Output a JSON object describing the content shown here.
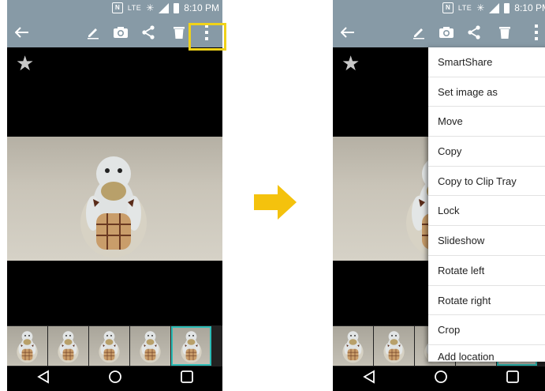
{
  "status_bar": {
    "lte": "LTE",
    "time": "8:10 PM",
    "nfc": "N"
  },
  "action_bar": {
    "icons": [
      "back-arrow-icon",
      "edit-icon",
      "camera-icon",
      "share-icon",
      "delete-icon",
      "overflow-menu-icon"
    ]
  },
  "viewer": {
    "favorite_icon": "star-icon"
  },
  "filmstrip": {
    "thumbnail_count": 5,
    "selected_index": 4
  },
  "nav_bar": {
    "icons": [
      "back-triangle-icon",
      "home-circle-icon",
      "recents-square-icon"
    ]
  },
  "overflow_menu": {
    "items": [
      "SmartShare",
      "Set image as",
      "Move",
      "Copy",
      "Copy to Clip Tray",
      "Lock",
      "Slideshow",
      "Rotate left",
      "Rotate right",
      "Crop",
      "Add location"
    ]
  },
  "colors": {
    "action_bar": "#879aa6",
    "highlight": "#f0d219",
    "arrow": "#f4c20d",
    "selected_thumb": "#2bbcb6"
  }
}
